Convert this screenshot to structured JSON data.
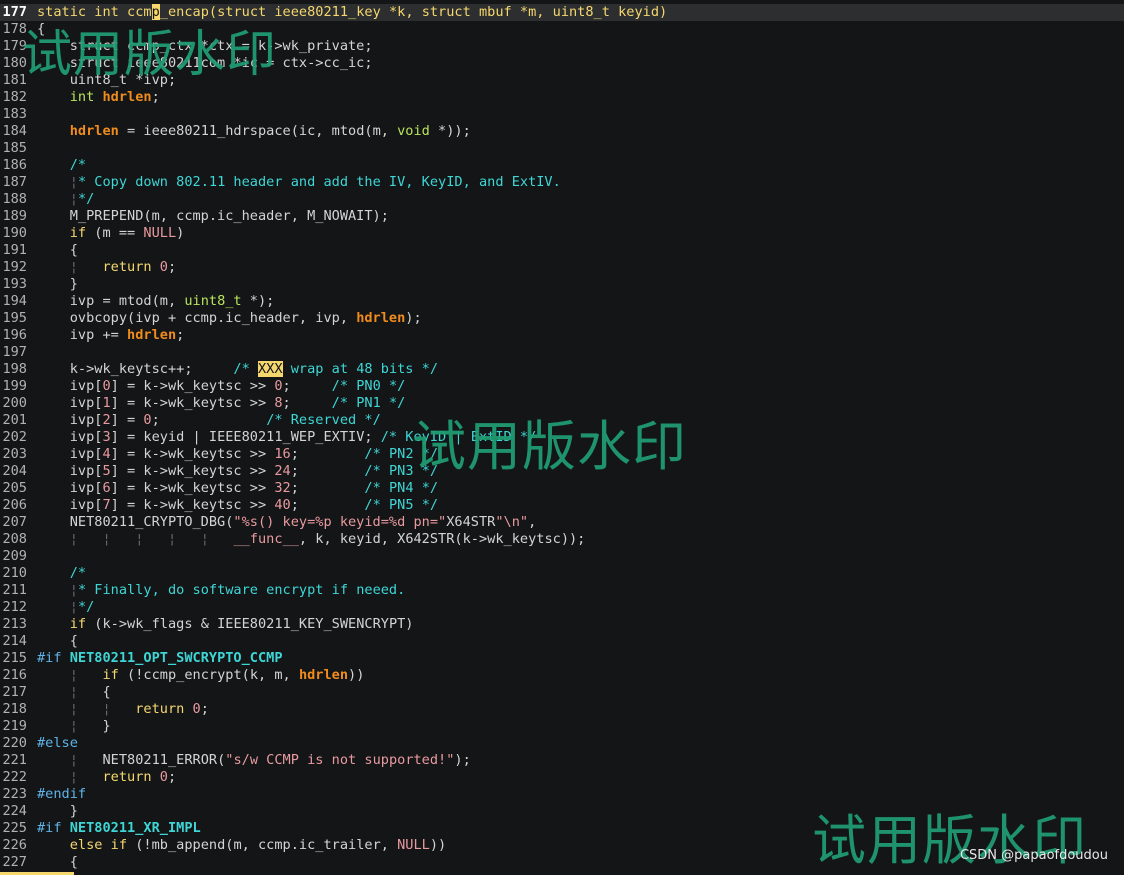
{
  "editor": {
    "lines": [
      {
        "n": "177",
        "cur": true,
        "t": [
          [
            "kw",
            "static "
          ],
          [
            "kw",
            "int "
          ],
          [
            "kw",
            "ccm"
          ],
          [
            "cursor",
            "p"
          ],
          [
            "kw",
            "_encap(struct ieee80211_key *k, struct mbuf *m, uint8_t keyid)"
          ]
        ]
      },
      {
        "n": "178",
        "t": [
          [
            "",
            "{"
          ]
        ]
      },
      {
        "n": "179",
        "t": [
          [
            "",
            "    struct ccmp_ctx *ctx = k->wk_private;"
          ]
        ]
      },
      {
        "n": "180",
        "t": [
          [
            "",
            "    struct ieee80211com *ic = ctx->cc_ic;"
          ]
        ]
      },
      {
        "n": "181",
        "t": [
          [
            "",
            "    uint8_t *ivp;"
          ]
        ]
      },
      {
        "n": "182",
        "t": [
          [
            "",
            "    "
          ],
          [
            "ty",
            "int "
          ],
          [
            "bv",
            "hdrlen"
          ],
          [
            "",
            ";"
          ]
        ]
      },
      {
        "n": "183",
        "t": []
      },
      {
        "n": "184",
        "t": [
          [
            "",
            "    "
          ],
          [
            "bv",
            "hdrlen"
          ],
          [
            "",
            " = ieee80211_hdrspace(ic, mtod(m, "
          ],
          [
            "ty",
            "void"
          ],
          [
            "",
            " *));"
          ]
        ]
      },
      {
        "n": "185",
        "t": []
      },
      {
        "n": "186",
        "t": [
          [
            "",
            "    "
          ],
          [
            "cm",
            "/*"
          ]
        ]
      },
      {
        "n": "187",
        "t": [
          [
            "",
            "    "
          ],
          [
            "g",
            "¦"
          ],
          [
            "cm",
            "* Copy down 802.11 header and add the IV, KeyID, and ExtIV."
          ]
        ]
      },
      {
        "n": "188",
        "t": [
          [
            "",
            "    "
          ],
          [
            "g",
            "¦"
          ],
          [
            "cm",
            "*/"
          ]
        ]
      },
      {
        "n": "189",
        "t": [
          [
            "",
            "    M_PREPEND(m, ccmp.ic_header, M_NOWAIT);"
          ]
        ]
      },
      {
        "n": "190",
        "t": [
          [
            "",
            "    "
          ],
          [
            "kw",
            "if"
          ],
          [
            "",
            " (m == "
          ],
          [
            "nm",
            "NULL"
          ],
          [
            "",
            ")"
          ]
        ]
      },
      {
        "n": "191",
        "t": [
          [
            "",
            "    {"
          ]
        ]
      },
      {
        "n": "192",
        "t": [
          [
            "",
            "    "
          ],
          [
            "g",
            "¦"
          ],
          [
            "",
            "   "
          ],
          [
            "kw",
            "return"
          ],
          [
            "",
            " "
          ],
          [
            "nm",
            "0"
          ],
          [
            "",
            ";"
          ]
        ]
      },
      {
        "n": "193",
        "t": [
          [
            "",
            "    }"
          ]
        ]
      },
      {
        "n": "194",
        "t": [
          [
            "",
            "    ivp = mtod(m, "
          ],
          [
            "ty",
            "uint8_t"
          ],
          [
            "",
            " *);"
          ]
        ]
      },
      {
        "n": "195",
        "t": [
          [
            "",
            "    ovbcopy(ivp + ccmp.ic_header, ivp, "
          ],
          [
            "bv",
            "hdrlen"
          ],
          [
            "",
            ");"
          ]
        ]
      },
      {
        "n": "196",
        "t": [
          [
            "",
            "    ivp += "
          ],
          [
            "bv",
            "hdrlen"
          ],
          [
            "",
            ";"
          ]
        ]
      },
      {
        "n": "197",
        "t": []
      },
      {
        "n": "198",
        "t": [
          [
            "",
            "    k->wk_keytsc++;     "
          ],
          [
            "cm",
            "/* "
          ],
          [
            "todo",
            "XXX"
          ],
          [
            "cm",
            " wrap at 48 bits */"
          ]
        ]
      },
      {
        "n": "199",
        "t": [
          [
            "",
            "    ivp["
          ],
          [
            "nm",
            "0"
          ],
          [
            "",
            "] = k->wk_keytsc >> "
          ],
          [
            "nm",
            "0"
          ],
          [
            "",
            ";     "
          ],
          [
            "cm",
            "/* PN0 */"
          ]
        ]
      },
      {
        "n": "200",
        "t": [
          [
            "",
            "    ivp["
          ],
          [
            "nm",
            "1"
          ],
          [
            "",
            "] = k->wk_keytsc >> "
          ],
          [
            "nm",
            "8"
          ],
          [
            "",
            ";     "
          ],
          [
            "cm",
            "/* PN1 */"
          ]
        ]
      },
      {
        "n": "201",
        "t": [
          [
            "",
            "    ivp["
          ],
          [
            "nm",
            "2"
          ],
          [
            "",
            "] = "
          ],
          [
            "nm",
            "0"
          ],
          [
            "",
            ";             "
          ],
          [
            "cm",
            "/* Reserved */"
          ]
        ]
      },
      {
        "n": "202",
        "t": [
          [
            "",
            "    ivp["
          ],
          [
            "nm",
            "3"
          ],
          [
            "",
            "] = keyid | IEEE80211_WEP_EXTIV; "
          ],
          [
            "cm",
            "/* KeyID | ExtID */"
          ]
        ]
      },
      {
        "n": "203",
        "t": [
          [
            "",
            "    ivp["
          ],
          [
            "nm",
            "4"
          ],
          [
            "",
            "] = k->wk_keytsc >> "
          ],
          [
            "nm",
            "16"
          ],
          [
            "",
            ";        "
          ],
          [
            "cm",
            "/* PN2 */"
          ]
        ]
      },
      {
        "n": "204",
        "t": [
          [
            "",
            "    ivp["
          ],
          [
            "nm",
            "5"
          ],
          [
            "",
            "] = k->wk_keytsc >> "
          ],
          [
            "nm",
            "24"
          ],
          [
            "",
            ";        "
          ],
          [
            "cm",
            "/* PN3 */"
          ]
        ]
      },
      {
        "n": "205",
        "t": [
          [
            "",
            "    ivp["
          ],
          [
            "nm",
            "6"
          ],
          [
            "",
            "] = k->wk_keytsc >> "
          ],
          [
            "nm",
            "32"
          ],
          [
            "",
            ";        "
          ],
          [
            "cm",
            "/* PN4 */"
          ]
        ]
      },
      {
        "n": "206",
        "t": [
          [
            "",
            "    ivp["
          ],
          [
            "nm",
            "7"
          ],
          [
            "",
            "] = k->wk_keytsc >> "
          ],
          [
            "nm",
            "40"
          ],
          [
            "",
            ";        "
          ],
          [
            "cm",
            "/* PN5 */"
          ]
        ]
      },
      {
        "n": "207",
        "t": [
          [
            "",
            "    NET80211_CRYPTO_DBG("
          ],
          [
            "st",
            "\"%s() key=%p keyid=%d pn=\""
          ],
          [
            "",
            "X64STR"
          ],
          [
            "st",
            "\"\\n\""
          ],
          [
            "",
            ","
          ]
        ]
      },
      {
        "n": "208",
        "t": [
          [
            "",
            "    "
          ],
          [
            "g",
            "¦   ¦   ¦   ¦   ¦   "
          ],
          [
            "nm",
            "__func__"
          ],
          [
            "",
            ", k, keyid, X642STR(k->wk_keytsc));"
          ]
        ]
      },
      {
        "n": "209",
        "t": []
      },
      {
        "n": "210",
        "t": [
          [
            "",
            "    "
          ],
          [
            "cm",
            "/*"
          ]
        ]
      },
      {
        "n": "211",
        "t": [
          [
            "",
            "    "
          ],
          [
            "g",
            "¦"
          ],
          [
            "cm",
            "* Finally, do software encrypt if neeed."
          ]
        ]
      },
      {
        "n": "212",
        "t": [
          [
            "",
            "    "
          ],
          [
            "g",
            "¦"
          ],
          [
            "cm",
            "*/"
          ]
        ]
      },
      {
        "n": "213",
        "t": [
          [
            "",
            "    "
          ],
          [
            "kw",
            "if"
          ],
          [
            "",
            " (k->wk_flags & IEEE80211_KEY_SWENCRYPT)"
          ]
        ]
      },
      {
        "n": "214",
        "t": [
          [
            "",
            "    {"
          ]
        ]
      },
      {
        "n": "215",
        "t": [
          [
            "pp",
            "#if "
          ],
          [
            "tg",
            "NET80211_OPT_SWCRYPTO_CCMP"
          ]
        ]
      },
      {
        "n": "216",
        "t": [
          [
            "",
            "    "
          ],
          [
            "g",
            "¦"
          ],
          [
            "",
            "   "
          ],
          [
            "kw",
            "if"
          ],
          [
            "",
            " (!ccmp_encrypt(k, m, "
          ],
          [
            "bv",
            "hdrlen"
          ],
          [
            "",
            "))"
          ]
        ]
      },
      {
        "n": "217",
        "t": [
          [
            "",
            "    "
          ],
          [
            "g",
            "¦"
          ],
          [
            "",
            "   {"
          ]
        ]
      },
      {
        "n": "218",
        "t": [
          [
            "",
            "    "
          ],
          [
            "g",
            "¦   ¦"
          ],
          [
            "",
            "   "
          ],
          [
            "kw",
            "return"
          ],
          [
            "",
            " "
          ],
          [
            "nm",
            "0"
          ],
          [
            "",
            ";"
          ]
        ]
      },
      {
        "n": "219",
        "t": [
          [
            "",
            "    "
          ],
          [
            "g",
            "¦"
          ],
          [
            "",
            "   }"
          ]
        ]
      },
      {
        "n": "220",
        "t": [
          [
            "pp",
            "#else"
          ]
        ]
      },
      {
        "n": "221",
        "t": [
          [
            "",
            "    "
          ],
          [
            "g",
            "¦"
          ],
          [
            "",
            "   NET80211_ERROR("
          ],
          [
            "st",
            "\"s/w CCMP is not supported!\""
          ],
          [
            "",
            ");"
          ]
        ]
      },
      {
        "n": "222",
        "t": [
          [
            "",
            "    "
          ],
          [
            "g",
            "¦"
          ],
          [
            "",
            "   "
          ],
          [
            "kw",
            "return"
          ],
          [
            "",
            " "
          ],
          [
            "nm",
            "0"
          ],
          [
            "",
            ";"
          ]
        ]
      },
      {
        "n": "223",
        "t": [
          [
            "pp",
            "#endif"
          ]
        ]
      },
      {
        "n": "224",
        "t": [
          [
            "",
            "    }"
          ]
        ]
      },
      {
        "n": "225",
        "t": [
          [
            "pp",
            "#if "
          ],
          [
            "tg",
            "NET80211_XR_IMPL"
          ]
        ]
      },
      {
        "n": "226",
        "t": [
          [
            "",
            "    "
          ],
          [
            "kw",
            "else if"
          ],
          [
            "",
            " (!mb_append(m, ccmp.ic_trailer, "
          ],
          [
            "nm",
            "NULL"
          ],
          [
            "",
            "))"
          ]
        ]
      },
      {
        "n": "227",
        "t": [
          [
            "",
            "    {"
          ]
        ]
      }
    ]
  },
  "watermarks": [
    "试用版水印",
    "试用版水印",
    "试用版水印"
  ],
  "credit": "CSDN @papaofdoudou",
  "colors": {
    "background": "#131516",
    "keyword": "#f5d76e",
    "type": "#b8e35c",
    "comment": "#3fd6d6",
    "string_number": "#e89aa0",
    "preprocessor": "#5fb3e8",
    "variable_bold": "#f08c1e",
    "watermark": "#1f9e74"
  }
}
